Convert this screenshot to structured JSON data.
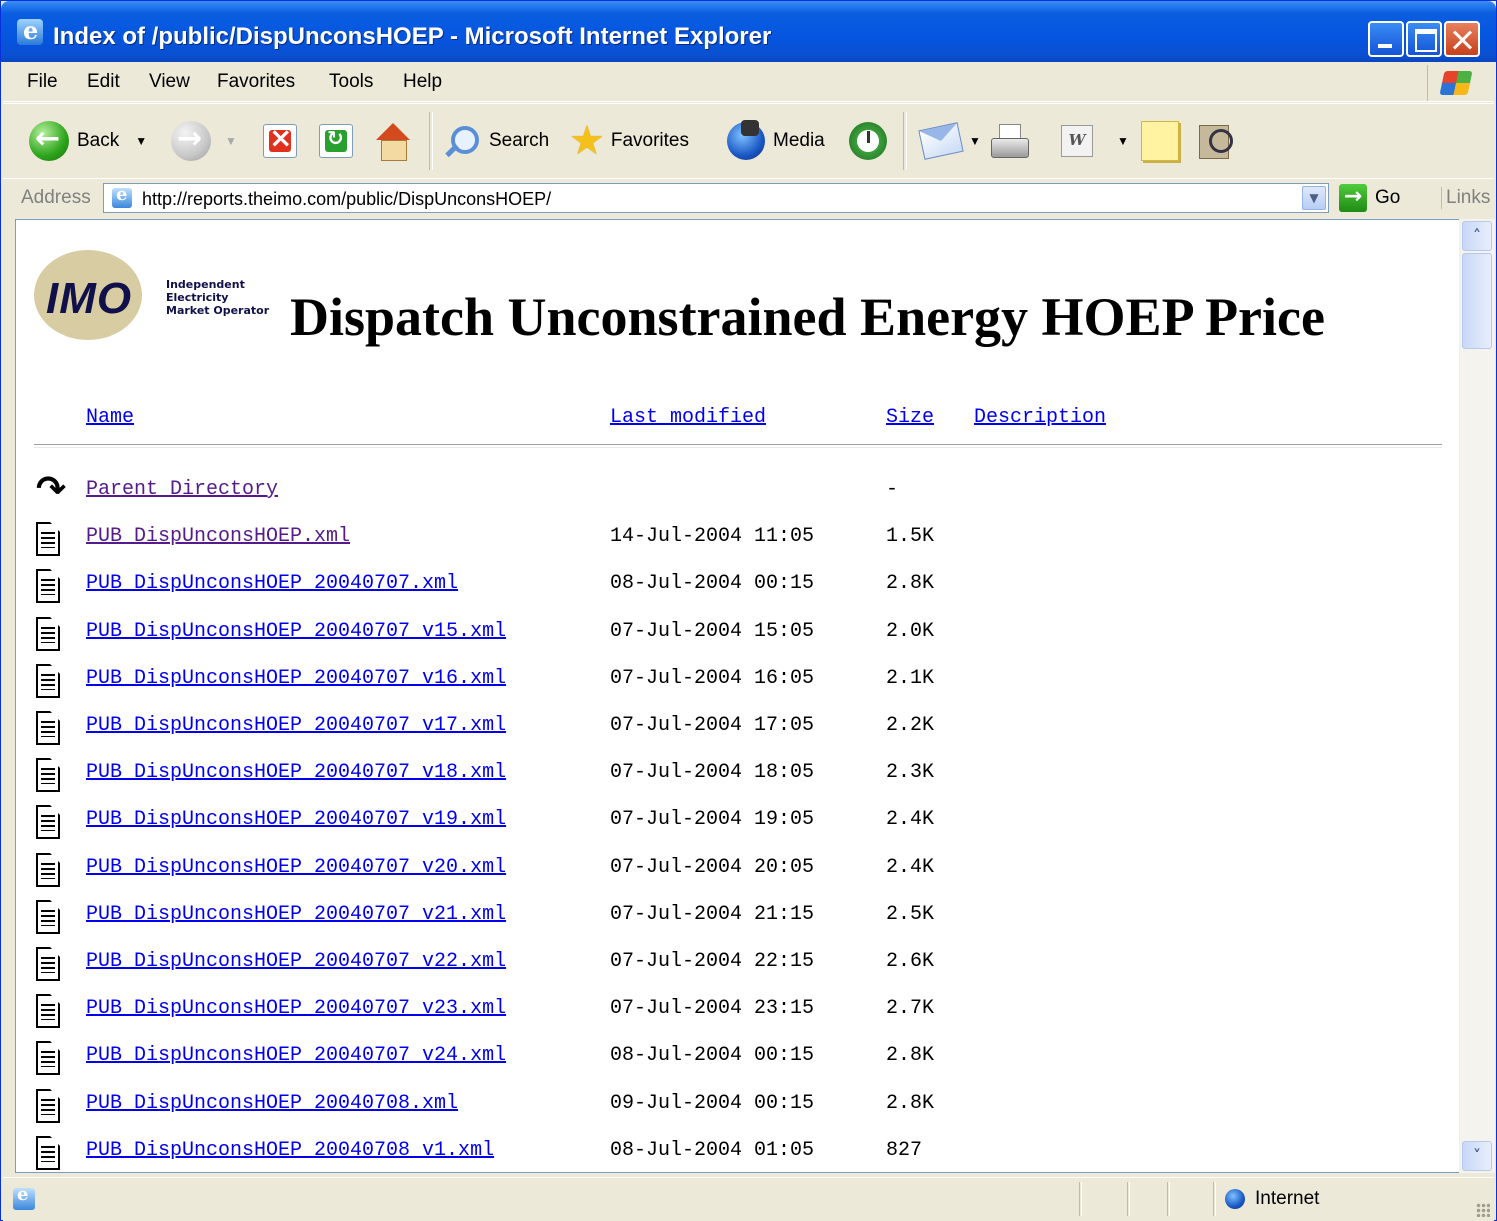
{
  "window": {
    "title": "Index of /public/DispUnconsHOEP - Microsoft Internet Explorer"
  },
  "menu": [
    "File",
    "Edit",
    "View",
    "Favorites",
    "Tools",
    "Help"
  ],
  "toolbar": {
    "back_label": "Back",
    "search_label": "Search",
    "favorites_label": "Favorites",
    "media_label": "Media"
  },
  "address": {
    "label": "Address",
    "url": "http://reports.theimo.com/public/DispUnconsHOEP/",
    "go_label": "Go",
    "links_label": "Links"
  },
  "page": {
    "logo_text": "IMO",
    "logo_subtext": "Independent\nElectricity\nMarket Operator",
    "heading": "Dispatch Unconstrained Energy HOEP Price",
    "columns": {
      "name": "Name",
      "last_modified": "Last modified",
      "size": "Size",
      "description": "Description"
    },
    "rows": [
      {
        "icon": "back-icon",
        "name": "Parent Directory",
        "date": "",
        "size": "-",
        "visited": true
      },
      {
        "icon": "doc-icon",
        "name": "PUB_DispUnconsHOEP.xml",
        "date": "14-Jul-2004 11:05",
        "size": "1.5K",
        "visited": true
      },
      {
        "icon": "doc-icon",
        "name": "PUB_DispUnconsHOEP_20040707.xml",
        "date": "08-Jul-2004 00:15",
        "size": "2.8K",
        "visited": false
      },
      {
        "icon": "doc-icon",
        "name": "PUB_DispUnconsHOEP_20040707_v15.xml",
        "date": "07-Jul-2004 15:05",
        "size": "2.0K",
        "visited": false
      },
      {
        "icon": "doc-icon",
        "name": "PUB_DispUnconsHOEP_20040707_v16.xml",
        "date": "07-Jul-2004 16:05",
        "size": "2.1K",
        "visited": false
      },
      {
        "icon": "doc-icon",
        "name": "PUB_DispUnconsHOEP_20040707_v17.xml",
        "date": "07-Jul-2004 17:05",
        "size": "2.2K",
        "visited": false
      },
      {
        "icon": "doc-icon",
        "name": "PUB_DispUnconsHOEP_20040707_v18.xml",
        "date": "07-Jul-2004 18:05",
        "size": "2.3K",
        "visited": false
      },
      {
        "icon": "doc-icon",
        "name": "PUB_DispUnconsHOEP_20040707_v19.xml",
        "date": "07-Jul-2004 19:05",
        "size": "2.4K",
        "visited": false
      },
      {
        "icon": "doc-icon",
        "name": "PUB_DispUnconsHOEP_20040707_v20.xml",
        "date": "07-Jul-2004 20:05",
        "size": "2.4K",
        "visited": false
      },
      {
        "icon": "doc-icon",
        "name": "PUB_DispUnconsHOEP_20040707_v21.xml",
        "date": "07-Jul-2004 21:15",
        "size": "2.5K",
        "visited": false
      },
      {
        "icon": "doc-icon",
        "name": "PUB_DispUnconsHOEP_20040707_v22.xml",
        "date": "07-Jul-2004 22:15",
        "size": "2.6K",
        "visited": false
      },
      {
        "icon": "doc-icon",
        "name": "PUB_DispUnconsHOEP_20040707_v23.xml",
        "date": "07-Jul-2004 23:15",
        "size": "2.7K",
        "visited": false
      },
      {
        "icon": "doc-icon",
        "name": "PUB_DispUnconsHOEP_20040707_v24.xml",
        "date": "08-Jul-2004 00:15",
        "size": "2.8K",
        "visited": false
      },
      {
        "icon": "doc-icon",
        "name": "PUB_DispUnconsHOEP_20040708.xml",
        "date": "09-Jul-2004 00:15",
        "size": "2.8K",
        "visited": false
      },
      {
        "icon": "doc-icon",
        "name": "PUB_DispUnconsHOEP_20040708_v1.xml",
        "date": "08-Jul-2004 01:05",
        "size": "827",
        "visited": false
      }
    ]
  },
  "status": {
    "zone": "Internet"
  },
  "colors": {
    "link": "#0000ee",
    "visited": "#551a8b",
    "titlebar": "#0555e0"
  }
}
